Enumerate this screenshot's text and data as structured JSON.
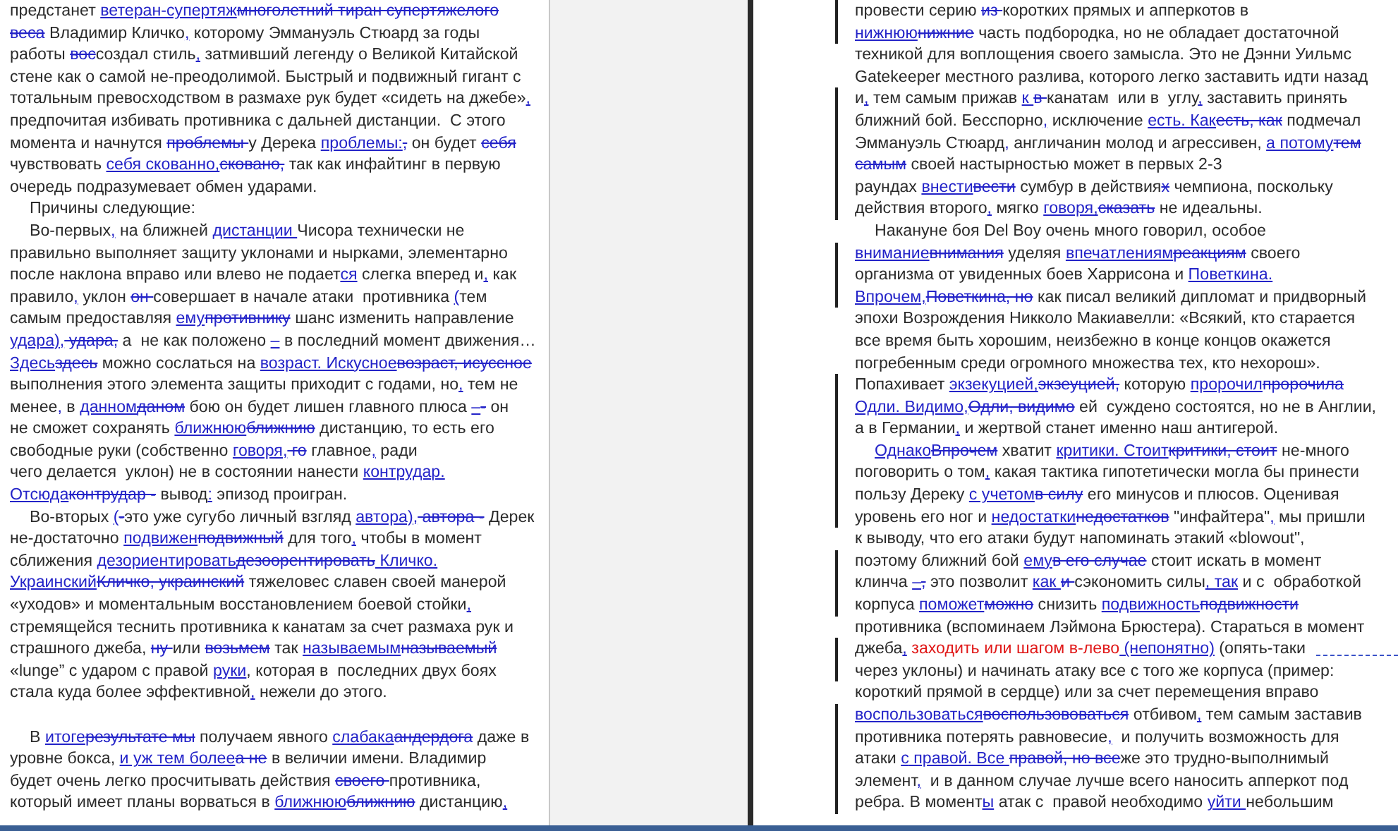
{
  "pages": [
    {
      "lines": [
        {
          "changed": false,
          "segments": [
            {
              "kind": "plain",
              "text": "предстанет "
            },
            {
              "kind": "ins",
              "text": "ветеран-супертяж"
            },
            {
              "kind": "del",
              "text": "многолетний тиран супертяжелого"
            }
          ]
        },
        {
          "changed": false,
          "segments": [
            {
              "kind": "del",
              "text": "веса"
            },
            {
              "kind": "plain",
              "text": " Владимир Кличко"
            },
            {
              "kind": "ins",
              "text": ","
            },
            {
              "kind": "plain",
              "text": " которому Эммануэль Стюард за годы"
            }
          ]
        },
        {
          "changed": false,
          "segments": [
            {
              "kind": "plain",
              "text": "работы "
            },
            {
              "kind": "del",
              "text": "вос"
            },
            {
              "kind": "plain",
              "text": "создал стиль"
            },
            {
              "kind": "ins",
              "text": ","
            },
            {
              "kind": "plain",
              "text": " затмивший легенду о Великой Китайской"
            }
          ]
        },
        {
          "changed": false,
          "segments": [
            {
              "kind": "plain",
              "text": "стене как о самой не-преодолимой. Быстрый и подвижный гигант с"
            }
          ]
        },
        {
          "changed": false,
          "segments": [
            {
              "kind": "plain",
              "text": "тотальным превосходством в размахе рук будет «сидеть на джебе»"
            },
            {
              "kind": "ins",
              "text": ","
            }
          ]
        },
        {
          "changed": false,
          "segments": [
            {
              "kind": "plain",
              "text": "предпочитая избивать противника с дальней дистанции.  С этого"
            }
          ]
        },
        {
          "changed": false,
          "segments": [
            {
              "kind": "plain",
              "text": "момента и начнутся "
            },
            {
              "kind": "del",
              "text": "проблемы "
            },
            {
              "kind": "plain",
              "text": "у Дерека "
            },
            {
              "kind": "ins",
              "text": "проблемы:"
            },
            {
              "kind": "del",
              "text": ","
            },
            {
              "kind": "plain",
              "text": " он будет "
            },
            {
              "kind": "del",
              "text": "себя"
            }
          ]
        },
        {
          "changed": false,
          "segments": [
            {
              "kind": "plain",
              "text": "чувствовать "
            },
            {
              "kind": "ins",
              "text": "себя скованно,"
            },
            {
              "kind": "del",
              "text": "сковано,"
            },
            {
              "kind": "plain",
              "text": " так как инфайтинг в первую"
            }
          ]
        },
        {
          "changed": false,
          "segments": [
            {
              "kind": "plain",
              "text": "очередь подразумевает обмен ударами."
            }
          ]
        },
        {
          "changed": false,
          "indent": true,
          "segments": [
            {
              "kind": "plain",
              "text": "Причины следующие:"
            }
          ]
        },
        {
          "changed": false,
          "indent": true,
          "segments": [
            {
              "kind": "plain",
              "text": "Во-первых"
            },
            {
              "kind": "ins",
              "text": ","
            },
            {
              "kind": "plain",
              "text": " на ближней "
            },
            {
              "kind": "ins",
              "text": "дистанции "
            },
            {
              "kind": "plain",
              "text": "Чисора технически не"
            }
          ]
        },
        {
          "changed": false,
          "segments": [
            {
              "kind": "plain",
              "text": "правильно выполняет защиту уклонами и нырками, элементарно"
            }
          ]
        },
        {
          "changed": false,
          "segments": [
            {
              "kind": "plain",
              "text": "после наклона вправо или влево не подает"
            },
            {
              "kind": "ins",
              "text": "ся"
            },
            {
              "kind": "plain",
              "text": " слегка вперед и"
            },
            {
              "kind": "ins",
              "text": ","
            },
            {
              "kind": "plain",
              "text": " как"
            }
          ]
        },
        {
          "changed": false,
          "segments": [
            {
              "kind": "plain",
              "text": "правило"
            },
            {
              "kind": "ins",
              "text": ","
            },
            {
              "kind": "plain",
              "text": " уклон "
            },
            {
              "kind": "del",
              "text": "он "
            },
            {
              "kind": "plain",
              "text": "совершает в начале атаки  противника "
            },
            {
              "kind": "ins",
              "text": "("
            },
            {
              "kind": "plain",
              "text": "тем"
            }
          ]
        },
        {
          "changed": false,
          "segments": [
            {
              "kind": "plain",
              "text": "самым предоставляя "
            },
            {
              "kind": "ins",
              "text": "ему"
            },
            {
              "kind": "del",
              "text": "противнику"
            },
            {
              "kind": "plain",
              "text": " шанс изменить направление"
            }
          ]
        },
        {
          "changed": false,
          "segments": [
            {
              "kind": "ins",
              "text": "удара),"
            },
            {
              "kind": "del",
              "text": " удара,"
            },
            {
              "kind": "plain",
              "text": " а  не как положено "
            },
            {
              "kind": "ins",
              "text": "–"
            },
            {
              "kind": "plain",
              "text": " в последний момент движения…"
            }
          ]
        },
        {
          "changed": false,
          "segments": [
            {
              "kind": "ins",
              "text": "Здесь"
            },
            {
              "kind": "del",
              "text": "здесь"
            },
            {
              "kind": "plain",
              "text": " можно сослаться на "
            },
            {
              "kind": "ins",
              "text": "возраст. Искусное"
            },
            {
              "kind": "del",
              "text": "возраст, исуссное"
            }
          ]
        },
        {
          "changed": false,
          "segments": [
            {
              "kind": "plain",
              "text": "выполнения этого элемента защиты приходит с годами, но"
            },
            {
              "kind": "ins",
              "text": ","
            },
            {
              "kind": "plain",
              "text": " тем не"
            }
          ]
        },
        {
          "changed": false,
          "segments": [
            {
              "kind": "plain",
              "text": "менее"
            },
            {
              "kind": "ins",
              "text": ","
            },
            {
              "kind": "plain",
              "text": " в "
            },
            {
              "kind": "ins",
              "text": "данном"
            },
            {
              "kind": "del",
              "text": "даном"
            },
            {
              "kind": "plain",
              "text": " бою он будет лишен главного плюса "
            },
            {
              "kind": "ins",
              "text": "–"
            },
            {
              "kind": "del",
              "text": "-"
            },
            {
              "kind": "plain",
              "text": " он"
            }
          ]
        },
        {
          "changed": false,
          "segments": [
            {
              "kind": "plain",
              "text": "не сможет сохранять "
            },
            {
              "kind": "ins",
              "text": "ближнюю"
            },
            {
              "kind": "del",
              "text": "ближнию"
            },
            {
              "kind": "plain",
              "text": " дистанцию, то есть его"
            }
          ]
        },
        {
          "changed": false,
          "segments": [
            {
              "kind": "plain",
              "text": "свободные руки (собственно "
            },
            {
              "kind": "ins",
              "text": "говоря,"
            },
            {
              "kind": "del",
              "text": " го"
            },
            {
              "kind": "plain",
              "text": " главное"
            },
            {
              "kind": "ins",
              "text": ","
            },
            {
              "kind": "plain",
              "text": " ради"
            }
          ]
        },
        {
          "changed": false,
          "segments": [
            {
              "kind": "plain",
              "text": "чего делается  уклон) не в состоянии нанести "
            },
            {
              "kind": "ins",
              "text": "контрудар."
            }
          ]
        },
        {
          "changed": false,
          "segments": [
            {
              "kind": "ins",
              "text": "Отсюда"
            },
            {
              "kind": "del",
              "text": "контрудар -"
            },
            {
              "kind": "plain",
              "text": " вывод"
            },
            {
              "kind": "ins",
              "text": ":"
            },
            {
              "kind": "plain",
              "text": " эпизод проигран."
            }
          ]
        },
        {
          "changed": false,
          "indent": true,
          "segments": [
            {
              "kind": "plain",
              "text": "Во-вторых "
            },
            {
              "kind": "ins",
              "text": "("
            },
            {
              "kind": "del",
              "text": "-"
            },
            {
              "kind": "plain",
              "text": "это уже сугубо личный взгляд "
            },
            {
              "kind": "ins",
              "text": "автора),"
            },
            {
              "kind": "del",
              "text": " автора -"
            },
            {
              "kind": "plain",
              "text": " Дерек"
            }
          ]
        },
        {
          "changed": false,
          "segments": [
            {
              "kind": "plain",
              "text": "не-достаточно "
            },
            {
              "kind": "ins",
              "text": "подвижен"
            },
            {
              "kind": "del",
              "text": "подвижный"
            },
            {
              "kind": "plain",
              "text": " для того"
            },
            {
              "kind": "ins",
              "text": ","
            },
            {
              "kind": "plain",
              "text": " чтобы в момент"
            }
          ]
        },
        {
          "changed": false,
          "segments": [
            {
              "kind": "plain",
              "text": "сближения "
            },
            {
              "kind": "ins",
              "text": "дезориентировать"
            },
            {
              "kind": "del",
              "text": "дезоорентировать"
            },
            {
              "kind": "ins",
              "text": " Кличко."
            }
          ]
        },
        {
          "changed": false,
          "segments": [
            {
              "kind": "ins",
              "text": "Украинский"
            },
            {
              "kind": "del",
              "text": "Кличко, украинский"
            },
            {
              "kind": "plain",
              "text": " тяжеловес славен своей манерой"
            }
          ]
        },
        {
          "changed": false,
          "segments": [
            {
              "kind": "plain",
              "text": "«уходов» и моментальным восстановлением боевой стойки"
            },
            {
              "kind": "ins",
              "text": ","
            }
          ]
        },
        {
          "changed": false,
          "segments": [
            {
              "kind": "plain",
              "text": "стремящейся теснить противника к канатам за счет размаха рук и"
            }
          ]
        },
        {
          "changed": false,
          "segments": [
            {
              "kind": "plain",
              "text": "страшного джеба, "
            },
            {
              "kind": "del",
              "text": "ну "
            },
            {
              "kind": "plain",
              "text": "или "
            },
            {
              "kind": "del",
              "text": "возьмем"
            },
            {
              "kind": "plain",
              "text": " так "
            },
            {
              "kind": "ins",
              "text": "называемым"
            },
            {
              "kind": "del",
              "text": "называемый"
            }
          ]
        },
        {
          "changed": false,
          "segments": [
            {
              "kind": "plain",
              "text": "«lunge” с ударом с правой "
            },
            {
              "kind": "ins",
              "text": "руки"
            },
            {
              "kind": "plain",
              "text": ", которая в  последних двух боях"
            }
          ]
        },
        {
          "changed": false,
          "segments": [
            {
              "kind": "plain",
              "text": "стала куда более эффективной"
            },
            {
              "kind": "ins",
              "text": ","
            },
            {
              "kind": "plain",
              "text": " нежели до этого."
            }
          ]
        },
        {
          "changed": false,
          "blank": true
        },
        {
          "changed": false,
          "indent": true,
          "segments": [
            {
              "kind": "plain",
              "text": "В "
            },
            {
              "kind": "ins",
              "text": "итоге"
            },
            {
              "kind": "del",
              "text": "результате мы"
            },
            {
              "kind": "plain",
              "text": " получаем явного "
            },
            {
              "kind": "ins",
              "text": "слабака"
            },
            {
              "kind": "del",
              "text": "андердога"
            },
            {
              "kind": "plain",
              "text": " даже в"
            }
          ]
        },
        {
          "changed": false,
          "segments": [
            {
              "kind": "plain",
              "text": "уровне бокса, "
            },
            {
              "kind": "ins",
              "text": "и уж тем более"
            },
            {
              "kind": "del",
              "text": "а не"
            },
            {
              "kind": "plain",
              "text": " в величии имени. Владимир"
            }
          ]
        },
        {
          "changed": false,
          "segments": [
            {
              "kind": "plain",
              "text": "будет очень легко просчитывать действия "
            },
            {
              "kind": "del",
              "text": "своего "
            },
            {
              "kind": "plain",
              "text": "противника,"
            }
          ]
        },
        {
          "changed": false,
          "segments": [
            {
              "kind": "plain",
              "text": "который имеет планы ворваться в "
            },
            {
              "kind": "ins",
              "text": "ближнюю"
            },
            {
              "kind": "del",
              "text": "ближнию"
            },
            {
              "kind": "plain",
              "text": " дистанцию"
            },
            {
              "kind": "ins",
              "text": ","
            }
          ]
        }
      ]
    },
    {
      "lines": [
        {
          "changed": true,
          "segments": [
            {
              "kind": "plain",
              "text": "провести серию "
            },
            {
              "kind": "del",
              "text": "из "
            },
            {
              "kind": "plain",
              "text": "коротких прямых и апперкотов в"
            }
          ]
        },
        {
          "changed": true,
          "segments": [
            {
              "kind": "ins",
              "text": "нижнюю"
            },
            {
              "kind": "del",
              "text": "нижние"
            },
            {
              "kind": "plain",
              "text": " часть подбородка, но не обладает достаточной"
            }
          ]
        },
        {
          "changed": false,
          "segments": [
            {
              "kind": "plain",
              "text": "техникой для воплощения своего замысла. Это не Дэнни Уильмс"
            }
          ]
        },
        {
          "changed": false,
          "segments": [
            {
              "kind": "plain",
              "text": "Gatekeeper местного разлива, которого легко заставить идти назад"
            }
          ]
        },
        {
          "changed": true,
          "segments": [
            {
              "kind": "plain",
              "text": "и"
            },
            {
              "kind": "ins",
              "text": ","
            },
            {
              "kind": "plain",
              "text": " тем самым прижав "
            },
            {
              "kind": "ins",
              "text": "к "
            },
            {
              "kind": "del",
              "text": "в "
            },
            {
              "kind": "plain",
              "text": "канатам  или в  углу"
            },
            {
              "kind": "ins",
              "text": ","
            },
            {
              "kind": "plain",
              "text": " заставить принять"
            }
          ]
        },
        {
          "changed": true,
          "segments": [
            {
              "kind": "plain",
              "text": "ближний бой. Бесспорно"
            },
            {
              "kind": "ins",
              "text": ","
            },
            {
              "kind": "plain",
              "text": " исключение "
            },
            {
              "kind": "ins",
              "text": "есть. Как"
            },
            {
              "kind": "del",
              "text": "есть, как"
            },
            {
              "kind": "plain",
              "text": " подмечал"
            }
          ]
        },
        {
          "changed": true,
          "segments": [
            {
              "kind": "plain",
              "text": "Эммануэль Стюард"
            },
            {
              "kind": "ins",
              "text": ","
            },
            {
              "kind": "plain",
              "text": " англичанин молод и агрессивен, "
            },
            {
              "kind": "ins",
              "text": "а потому"
            },
            {
              "kind": "del",
              "text": "тем"
            }
          ]
        },
        {
          "changed": true,
          "segments": [
            {
              "kind": "del",
              "text": "самым"
            },
            {
              "kind": "plain",
              "text": " своей настырностью может в первых 2-3"
            }
          ]
        },
        {
          "changed": true,
          "segments": [
            {
              "kind": "plain",
              "text": "раундах "
            },
            {
              "kind": "ins",
              "text": "внести"
            },
            {
              "kind": "del",
              "text": "вести"
            },
            {
              "kind": "plain",
              "text": " сумбур в действия"
            },
            {
              "kind": "del",
              "text": "х"
            },
            {
              "kind": "plain",
              "text": " чемпиона, поскольку"
            }
          ]
        },
        {
          "changed": true,
          "segments": [
            {
              "kind": "plain",
              "text": "действия второго"
            },
            {
              "kind": "ins",
              "text": ","
            },
            {
              "kind": "plain",
              "text": " мягко "
            },
            {
              "kind": "ins",
              "text": "говоря,"
            },
            {
              "kind": "del",
              "text": "сказать"
            },
            {
              "kind": "plain",
              "text": " не идеальны."
            }
          ]
        },
        {
          "changed": false,
          "indent": true,
          "segments": [
            {
              "kind": "plain",
              "text": "Накануне боя Del Boy очень много говорил, особое"
            }
          ]
        },
        {
          "changed": true,
          "segments": [
            {
              "kind": "ins",
              "text": "внимание"
            },
            {
              "kind": "del",
              "text": "внимания"
            },
            {
              "kind": "plain",
              "text": " уделяя "
            },
            {
              "kind": "ins",
              "text": "впечатлениям"
            },
            {
              "kind": "del",
              "text": "реакциям"
            },
            {
              "kind": "plain",
              "text": " своего"
            }
          ]
        },
        {
          "changed": true,
          "segments": [
            {
              "kind": "plain",
              "text": "организма от увиденных боев Харрисона и "
            },
            {
              "kind": "ins",
              "text": "Поветкина."
            }
          ]
        },
        {
          "changed": true,
          "segments": [
            {
              "kind": "ins",
              "text": "Впрочем,"
            },
            {
              "kind": "del",
              "text": "Поветкина, но"
            },
            {
              "kind": "plain",
              "text": " как писал великий дипломат и придворный"
            }
          ]
        },
        {
          "changed": false,
          "segments": [
            {
              "kind": "plain",
              "text": "эпохи Возрождения Никколо Макиавелли: «Всякий, кто старается"
            }
          ]
        },
        {
          "changed": false,
          "segments": [
            {
              "kind": "plain",
              "text": "все время быть хорошим, неизбежно в конце концов окажется"
            }
          ]
        },
        {
          "changed": false,
          "segments": [
            {
              "kind": "plain",
              "text": "погребенным среди огромного множества тех, кто нехорош»."
            }
          ]
        },
        {
          "changed": true,
          "segments": [
            {
              "kind": "plain",
              "text": "Попахивает "
            },
            {
              "kind": "ins",
              "text": "экзекуцией,"
            },
            {
              "kind": "del",
              "text": "экзеуцией,"
            },
            {
              "kind": "plain",
              "text": " которую "
            },
            {
              "kind": "ins",
              "text": "пророчил"
            },
            {
              "kind": "del",
              "text": "пророчила"
            }
          ]
        },
        {
          "changed": true,
          "segments": [
            {
              "kind": "ins",
              "text": "Одли. Видимо,"
            },
            {
              "kind": "del",
              "text": "Одли, видимо"
            },
            {
              "kind": "plain",
              "text": " ей  суждено состоятся, но не в Англии,"
            }
          ]
        },
        {
          "changed": true,
          "segments": [
            {
              "kind": "plain",
              "text": "а в Германии"
            },
            {
              "kind": "ins",
              "text": ","
            },
            {
              "kind": "plain",
              "text": " и жертвой станет именно наш антигерой."
            }
          ]
        },
        {
          "changed": true,
          "indent": true,
          "segments": [
            {
              "kind": "ins",
              "text": "Однако"
            },
            {
              "kind": "del",
              "text": "Впрочем"
            },
            {
              "kind": "plain",
              "text": " хватит "
            },
            {
              "kind": "ins",
              "text": "критики. Стоит"
            },
            {
              "kind": "del",
              "text": "критики, стоит"
            },
            {
              "kind": "plain",
              "text": " не-много"
            }
          ]
        },
        {
          "changed": true,
          "segments": [
            {
              "kind": "plain",
              "text": "поговорить о том"
            },
            {
              "kind": "ins",
              "text": ","
            },
            {
              "kind": "plain",
              "text": " какая тактика гипотетически могла бы принести"
            }
          ]
        },
        {
          "changed": true,
          "segments": [
            {
              "kind": "plain",
              "text": "пользу Дереку "
            },
            {
              "kind": "ins",
              "text": "с учетом"
            },
            {
              "kind": "del",
              "text": "в силу"
            },
            {
              "kind": "plain",
              "text": " его минусов и плюсов. Оценивая"
            }
          ]
        },
        {
          "changed": true,
          "segments": [
            {
              "kind": "plain",
              "text": "уровень его ног и "
            },
            {
              "kind": "ins",
              "text": "недостатки"
            },
            {
              "kind": "del",
              "text": "недостатков"
            },
            {
              "kind": "plain",
              "text": " \"инфайтера\""
            },
            {
              "kind": "ins",
              "text": ","
            },
            {
              "kind": "plain",
              "text": " мы пришли"
            }
          ]
        },
        {
          "changed": false,
          "segments": [
            {
              "kind": "plain",
              "text": "к выводу, что его атаки будут напоминать этакий «blowout\","
            }
          ]
        },
        {
          "changed": true,
          "segments": [
            {
              "kind": "plain",
              "text": "поэтому ближний бой "
            },
            {
              "kind": "ins",
              "text": "ему"
            },
            {
              "kind": "del",
              "text": "в его случае"
            },
            {
              "kind": "plain",
              "text": " стоит искать в момент"
            }
          ]
        },
        {
          "changed": true,
          "segments": [
            {
              "kind": "plain",
              "text": "клинча "
            },
            {
              "kind": "ins",
              "text": "–"
            },
            {
              "kind": "del",
              "text": ","
            },
            {
              "kind": "plain",
              "text": " это позволит "
            },
            {
              "kind": "ins",
              "text": "как "
            },
            {
              "kind": "del",
              "text": "и "
            },
            {
              "kind": "plain",
              "text": "сэкономить силы"
            },
            {
              "kind": "ins",
              "text": ", так"
            },
            {
              "kind": "plain",
              "text": " и с  обработкой"
            }
          ]
        },
        {
          "changed": true,
          "segments": [
            {
              "kind": "plain",
              "text": "корпуса "
            },
            {
              "kind": "ins",
              "text": "поможет"
            },
            {
              "kind": "del",
              "text": "можно"
            },
            {
              "kind": "plain",
              "text": " снизить "
            },
            {
              "kind": "ins",
              "text": "подвижность"
            },
            {
              "kind": "del",
              "text": "подвижности"
            }
          ]
        },
        {
          "changed": false,
          "segments": [
            {
              "kind": "plain",
              "text": "противника (вспоминаем Лэймона Брюстера). Стараться в момент"
            }
          ]
        },
        {
          "changed": true,
          "comment": true,
          "segments": [
            {
              "kind": "plain",
              "text": "джеба"
            },
            {
              "kind": "ins",
              "text": ","
            },
            {
              "kind": "red",
              "text": " заходить или шагом в-лево"
            },
            {
              "kind": "ins",
              "text": " (непонятно)"
            },
            {
              "kind": "plain",
              "text": " (опять-таки"
            }
          ]
        },
        {
          "changed": true,
          "segments": [
            {
              "kind": "plain",
              "text": "через уклоны) и начинать атаку все с того же корпуса (пример:"
            }
          ]
        },
        {
          "changed": false,
          "segments": [
            {
              "kind": "plain",
              "text": "короткий прямой в сердце) или за счет перемещения вправо"
            }
          ]
        },
        {
          "changed": true,
          "segments": [
            {
              "kind": "ins",
              "text": "воспользоваться"
            },
            {
              "kind": "del",
              "text": "воспользововаться"
            },
            {
              "kind": "plain",
              "text": " отбивом"
            },
            {
              "kind": "ins",
              "text": ","
            },
            {
              "kind": "plain",
              "text": " тем самым заставив"
            }
          ]
        },
        {
          "changed": true,
          "segments": [
            {
              "kind": "plain",
              "text": "противника потерять равновесие"
            },
            {
              "kind": "ins",
              "text": ","
            },
            {
              "kind": "plain",
              "text": "  и получить возможность для"
            }
          ]
        },
        {
          "changed": true,
          "segments": [
            {
              "kind": "plain",
              "text": "атаки "
            },
            {
              "kind": "ins",
              "text": "с"
            },
            {
              "kind": "ins",
              "text": " правой. Все "
            },
            {
              "kind": "del",
              "text": "правой, но все"
            },
            {
              "kind": "plain",
              "text": "же это трудно-выполнимый"
            }
          ]
        },
        {
          "changed": true,
          "segments": [
            {
              "kind": "plain",
              "text": "элемент"
            },
            {
              "kind": "ins",
              "text": ","
            },
            {
              "kind": "plain",
              "text": "  и в данном случае лучше всего наносить апперкот под"
            }
          ]
        },
        {
          "changed": true,
          "segments": [
            {
              "kind": "plain",
              "text": "ребра. В момент"
            },
            {
              "kind": "ins",
              "text": "ы"
            },
            {
              "kind": "plain",
              "text": " атак с  правой необходимо "
            },
            {
              "kind": "ins",
              "text": "уйти "
            },
            {
              "kind": "plain",
              "text": "небольшим"
            }
          ]
        }
      ]
    }
  ]
}
